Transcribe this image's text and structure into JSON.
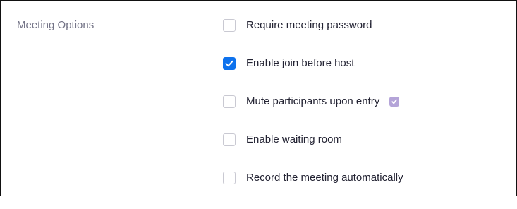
{
  "section": {
    "label": "Meeting Options"
  },
  "options": [
    {
      "label": "Require meeting password",
      "checked": false
    },
    {
      "label": "Enable join before host",
      "checked": true
    },
    {
      "label": "Mute participants upon entry",
      "checked": false,
      "badge_icon": "info-badge-icon"
    },
    {
      "label": "Enable waiting room",
      "checked": false
    },
    {
      "label": "Record the meeting automatically",
      "checked": false
    }
  ],
  "colors": {
    "accent": "#0e72ed",
    "label_gray": "#747487",
    "text": "#232333",
    "badge": "#b4a4d8"
  }
}
